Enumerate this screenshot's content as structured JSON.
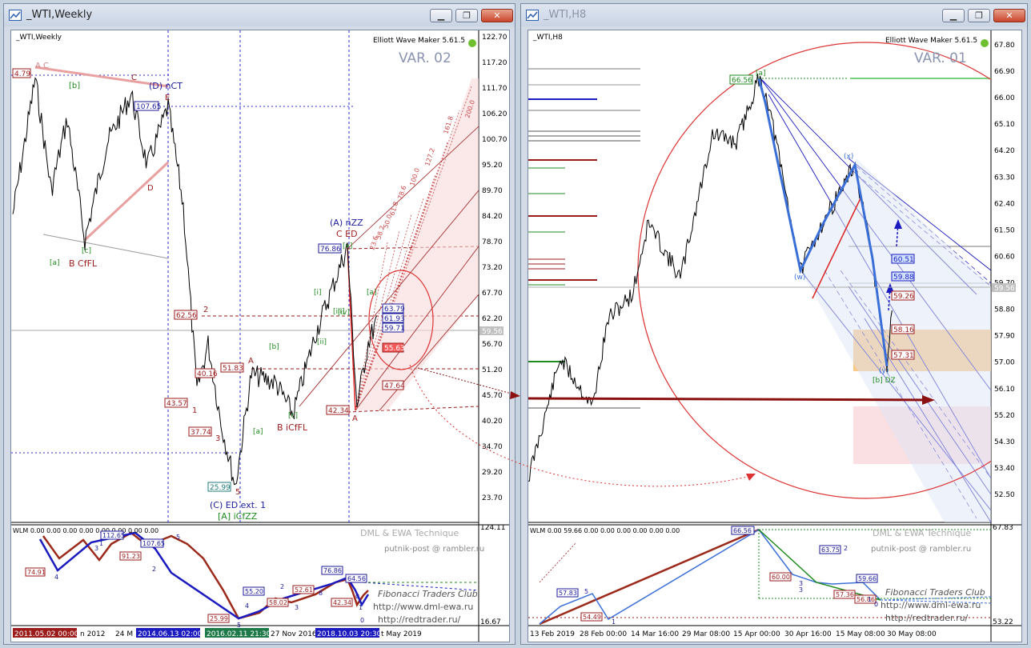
{
  "left": {
    "title": "_WTI,Weekly",
    "symbol_label": "_WTI,Weekly",
    "brand": "Elliott Wave Maker 5.61.5",
    "variant": "VAR. 02",
    "price_axis": [
      "122.70",
      "117.20",
      "111.70",
      "106.20",
      "100.70",
      "95.20",
      "89.70",
      "84.20",
      "78.70",
      "73.20",
      "67.70",
      "62.20",
      "56.70",
      "51.20",
      "45.70",
      "40.20",
      "34.70",
      "29.20",
      "23.70"
    ],
    "current_price": "59.56",
    "wave_labels": {
      "a_c_top": "A C",
      "b_top": "[b]",
      "c_top": "C",
      "d_nct": "(D) nCT",
      "e": "E",
      "d": "D",
      "c_br": "[c]",
      "a_br": "[a]",
      "b_cffl": "B CfFL",
      "two": "2",
      "one": "1",
      "three": "3",
      "a_mid": "A",
      "c_mid": "[c]",
      "b_icffl": "B iCfFL",
      "a_br2": "[a]",
      "b_br2": "[b]",
      "five": "5",
      "c_ed_ext": "(C) ED ext. 1",
      "a_icfzz": "[A] iCfZZ",
      "i": "[i]",
      "ii": "[ii]",
      "iii": "[iii]",
      "iv": "[iv]",
      "v": "[v]",
      "a_nzz": "(A) nZZ",
      "c_ed": "C ED",
      "a_low": "A",
      "a_sm": "[a]"
    },
    "price_tags": [
      "4.79",
      "107.65",
      "62.56",
      "51.83",
      "43.57",
      "37.74",
      "25.99",
      "42.34",
      "76.86",
      "63.79",
      "61.93",
      "59.71",
      "55.63",
      "47.64",
      "40.16"
    ],
    "fib_labels": [
      "200.0",
      "161.8",
      "127.2",
      "100.0",
      "78.6",
      "61.8",
      "50.0",
      "38.2",
      "23.6"
    ],
    "sub": {
      "label": "WLM 0.00 0.00 0.00 0.00 0.00 0.00 0.00 0.00",
      "technique": "DML & EWA Technique",
      "email": "putnik-post @ rambler.ru",
      "ftc": "Fibonacci Traders Club",
      "url1": "http://www.dml-ewa.ru",
      "url2": "http://redtrader.ru/",
      "axis_top": "124.11",
      "axis_bottom": "16.67",
      "values": [
        "74.91",
        "91.23",
        "112.65",
        "107.65",
        "55.20",
        "58.02",
        "52.61",
        "76.86",
        "64.56",
        "42.34",
        "25.99"
      ],
      "wave_nums": [
        "4",
        "3",
        "2",
        "1",
        "5",
        "4",
        "3",
        "2",
        "0",
        "1",
        "0",
        "5",
        "8"
      ]
    },
    "time_axis": [
      "2011.05.02 00:00",
      "n 2012",
      "24 M",
      "2014.06.13 02:00",
      "2016.02.11 21:30",
      "27 Nov 2016",
      "2018.10.03 20:30",
      "t May 2019"
    ]
  },
  "right": {
    "title": "_WTI,H8",
    "symbol_label": "_WTI,H8",
    "brand": "Elliott Wave Maker 5.61.5",
    "variant": "VAR. 01",
    "price_axis": [
      "67.80",
      "66.90",
      "66.00",
      "65.10",
      "64.20",
      "63.30",
      "62.40",
      "61.50",
      "60.60",
      "59.70",
      "58.80",
      "57.90",
      "57.00",
      "56.10",
      "55.20",
      "54.30",
      "53.40",
      "52.50"
    ],
    "current_price": "59.56",
    "wave_labels": {
      "a": "[a]",
      "x": "(x)",
      "w": "(w)",
      "y": "(y)",
      "b_dz": "[b] DZ"
    },
    "price_tags": [
      "66.56",
      "60.51",
      "59.88",
      "59.26",
      "58.16",
      "57.31"
    ],
    "sub": {
      "label": "WLM 0.00 59.66 0.00 0.00 0.00 0.00 0.00 0.00",
      "technique": "DML & EWA Technique",
      "email": "putnik-post @ rambler.ru",
      "ftc": "Fibonacci Traders Club",
      "url1": "http://www.dml-ewa.ru",
      "url2": "http://redtrader.ru/",
      "axis_top": "67.83",
      "axis_bottom": "53.22",
      "values": [
        "66.56",
        "57.83",
        "54.49",
        "60.00",
        "63.75",
        "59.66",
        "57.36",
        "56.86"
      ],
      "wave_nums": [
        "5",
        "3",
        "1",
        "3",
        "2",
        "0",
        "1"
      ]
    },
    "time_axis": [
      "13 Feb 2019",
      "28 Feb 00:00",
      "14 Mar 16:00",
      "29 Mar 08:00",
      "15 Apr 00:00",
      "30 Apr 16:00",
      "15 May 08:00",
      "30 May 08:00"
    ]
  },
  "colors": {
    "up": "#1b1b9c",
    "down": "#9c1b1b",
    "green": "#1f8a1f",
    "fib": "#c84848",
    "grid": "#2a2ad0",
    "zone_orange": "#f7c074",
    "zone_pink": "#f7c9d0"
  }
}
